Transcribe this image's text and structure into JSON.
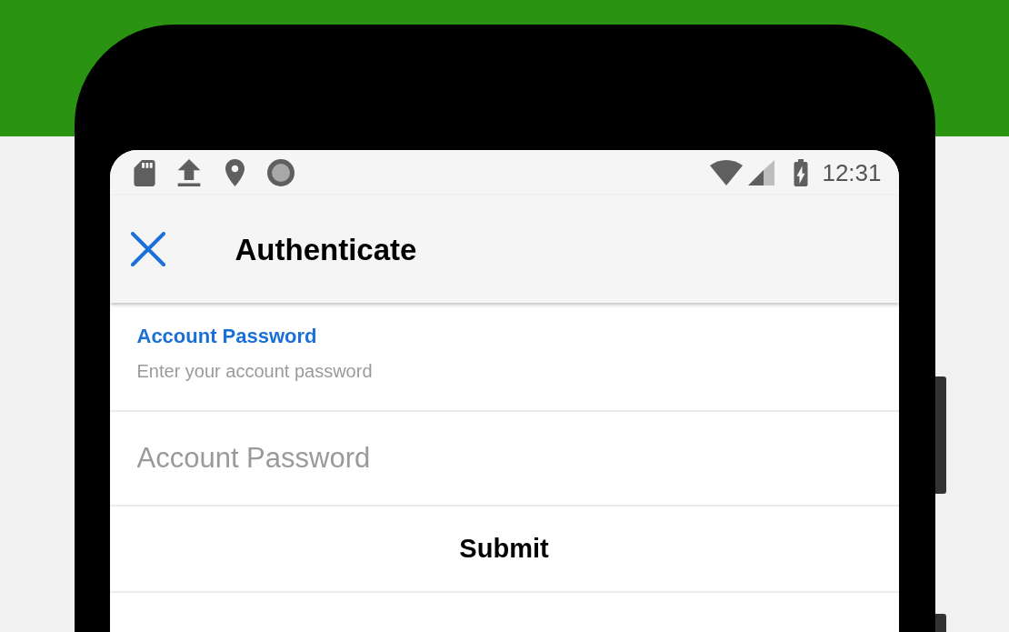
{
  "status_bar": {
    "time": "12:31"
  },
  "app_bar": {
    "title": "Authenticate"
  },
  "section": {
    "title": "Account Password",
    "description": "Enter your account password"
  },
  "password_field": {
    "placeholder": "Account Password"
  },
  "submit_button": {
    "label": "Submit"
  }
}
